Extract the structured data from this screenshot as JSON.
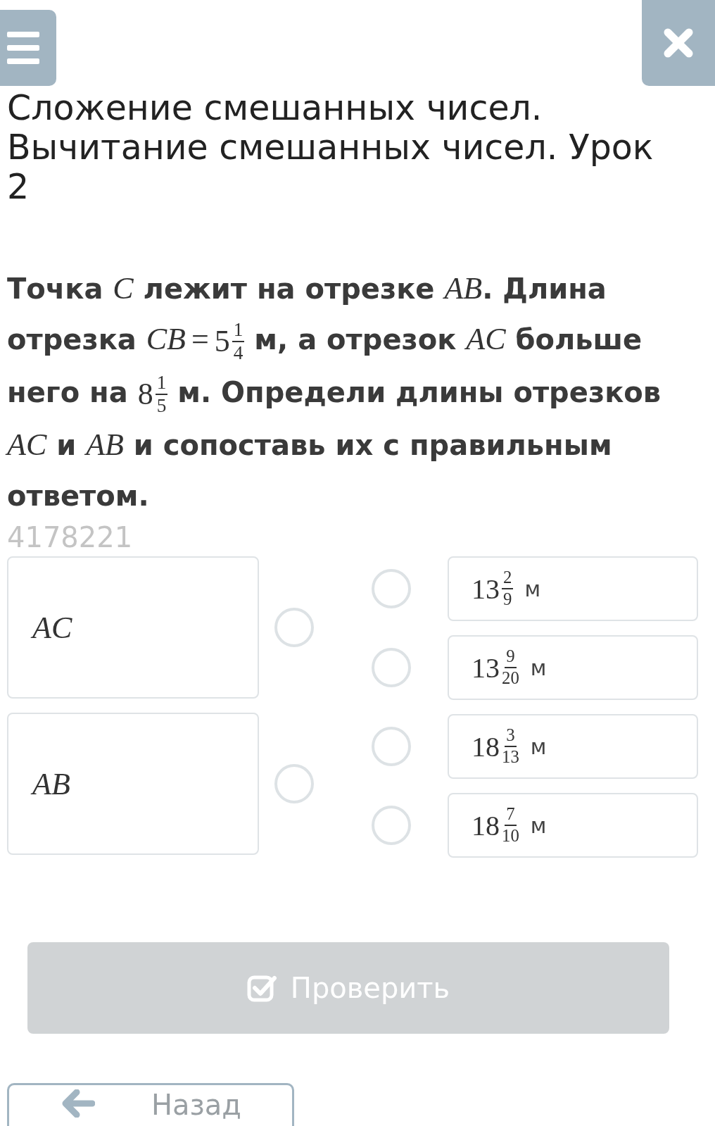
{
  "title": "Сложение смешанных чисел. Вычитание смешанных чисел. Урок 2",
  "question": [
    {
      "kind": "text",
      "text": "Точка "
    },
    {
      "kind": "math",
      "text": "C"
    },
    {
      "kind": "text",
      "text": " лежит на отрезке "
    },
    {
      "kind": "math",
      "text": "AB"
    },
    {
      "kind": "text",
      "text": ". Длина отрезка "
    },
    {
      "kind": "math",
      "text": "CB"
    },
    {
      "kind": "op",
      "text": "="
    },
    {
      "kind": "mixed",
      "whole": "5",
      "num": "1",
      "den": "4"
    },
    {
      "kind": "text",
      "text": " м, а отрезок "
    },
    {
      "kind": "math",
      "text": "AC"
    },
    {
      "kind": "text",
      "text": " больше него на "
    },
    {
      "kind": "mixed",
      "whole": "8",
      "num": "1",
      "den": "5"
    },
    {
      "kind": "text",
      "text": " м. Определи длины отрезков "
    },
    {
      "kind": "math",
      "text": "AC"
    },
    {
      "kind": "text",
      "text": " и "
    },
    {
      "kind": "math",
      "text": "AB"
    },
    {
      "kind": "text",
      "text": " и сопоставь их с правильным ответом."
    }
  ],
  "task_id": "4178221",
  "left_items": [
    {
      "label": "AC",
      "selected": false
    },
    {
      "label": "AB",
      "selected": false
    }
  ],
  "right_items": [
    {
      "whole": "13",
      "num": "2",
      "den": "9",
      "unit": "м",
      "selected": false
    },
    {
      "whole": "13",
      "num": "9",
      "den": "20",
      "unit": "м",
      "selected": false
    },
    {
      "whole": "18",
      "num": "3",
      "den": "13",
      "unit": "м",
      "selected": false
    },
    {
      "whole": "18",
      "num": "7",
      "den": "10",
      "unit": "м",
      "selected": false
    }
  ],
  "check_button": {
    "label": "Проверить",
    "disabled": true
  },
  "back_button": {
    "label": "Назад"
  }
}
